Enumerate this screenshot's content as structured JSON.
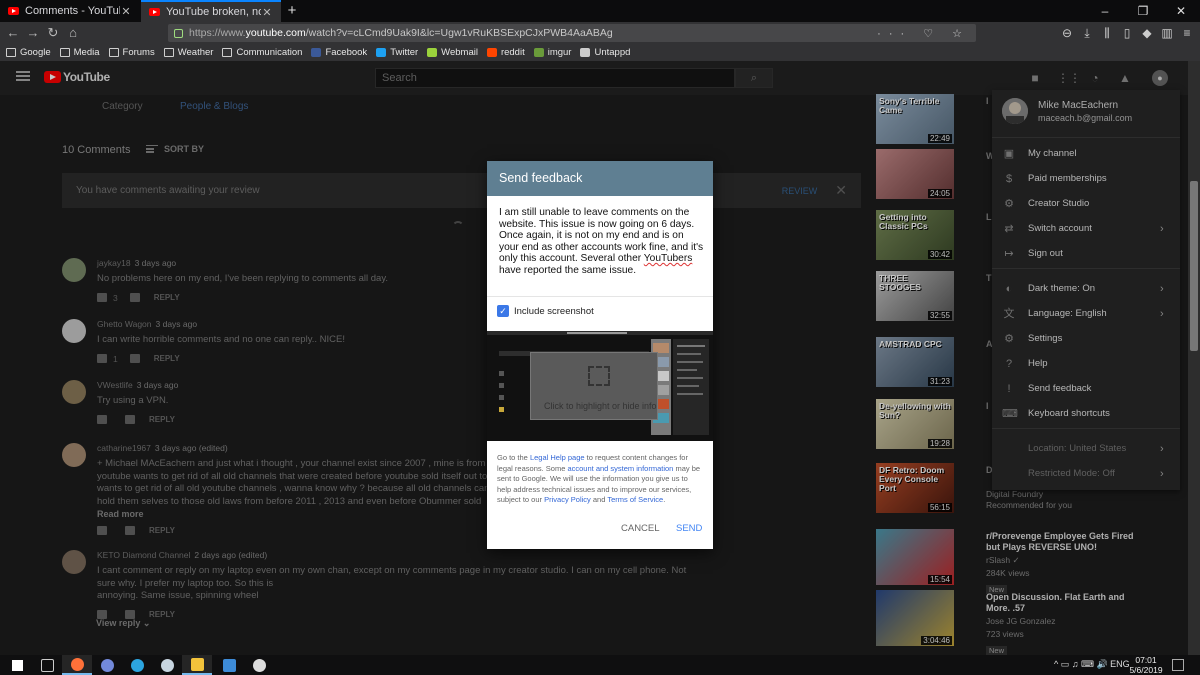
{
  "browser": {
    "tabs": [
      {
        "title": "Comments - YouTube",
        "active": false
      },
      {
        "title": "YouTube broken, no longer can...",
        "active": true
      }
    ],
    "new_tab_glyph": "+",
    "window_controls": [
      "–",
      "❐",
      "✕"
    ],
    "url_scheme": "https://www.",
    "url_host": "youtube.com",
    "url_path": "/watch?v=cLCmd9Uak9I&lc=Ugw1vRuKBSExpCJxPWB4AaABAg",
    "url_icons": "··· ♡ ☆",
    "bookmarks": [
      {
        "label": "Google",
        "icon": "folder-icon"
      },
      {
        "label": "Media",
        "icon": "folder-icon"
      },
      {
        "label": "Forums",
        "icon": "folder-icon"
      },
      {
        "label": "Weather",
        "icon": "folder-icon"
      },
      {
        "label": "Communication",
        "icon": "folder-icon"
      },
      {
        "label": "Facebook",
        "icon": "facebook-icon",
        "color": "#3b5998"
      },
      {
        "label": "Twitter",
        "icon": "twitter-icon",
        "color": "#1da1f2"
      },
      {
        "label": "Webmail",
        "icon": "webmail-icon",
        "color": "#9bd33c"
      },
      {
        "label": "reddit",
        "icon": "reddit-icon",
        "color": "#ff4500"
      },
      {
        "label": "imgur",
        "icon": "imgur-icon",
        "color": "#6a9b3a"
      },
      {
        "label": "Untappd",
        "icon": "untappd-icon",
        "color": "#cccccc"
      }
    ]
  },
  "youtube": {
    "logo_text": "YouTube",
    "search_placeholder": "Search",
    "category_label": "Category",
    "category_value": "People & Blogs",
    "comment_count": "10 Comments",
    "sort_label": "SORT BY",
    "review_banner": {
      "text": "You have comments awaiting your review",
      "button": "REVIEW",
      "close": "✕"
    },
    "reply_label": "REPLY",
    "comments": [
      {
        "author": "jaykay18",
        "time": "3 days ago",
        "lines": [
          "No problems here on my end, I've been replying to comments all day."
        ],
        "likes": "3",
        "avatar_color": "#7a8a6a"
      },
      {
        "author": "Ghetto Wagon",
        "time": "3 days ago",
        "lines": [
          "I can write horrible comments and no one can reply.. NICE!"
        ],
        "likes": "1",
        "avatar_color": "#c8c8c8"
      },
      {
        "author": "VWestlife",
        "time": "3 days ago",
        "lines": [
          "Try using a VPN."
        ],
        "likes": "",
        "avatar_color": "#8c7a5a"
      },
      {
        "author": "catharine1967",
        "time": "3 days ago (edited)",
        "lines": [
          "+ Michael MAcEachern and just what i thought , your channel exist since 2007 , mine is from 2009 ,",
          "youtube wants to get rid of all old channels that were created before youtube sold itself out to google,",
          "wants to get rid of all old youtube channels , wanna know why ? because all old channels can still",
          "hold them selves to those old laws from before 2011 , 2013 and even before Obummer sold"
        ],
        "read_more": "Read more",
        "likes": "",
        "avatar_color": "#a58a70"
      },
      {
        "author": "KETO Diamond Channel",
        "time": "2 days ago (edited)",
        "lines": [
          "I cant comment or reply on my laptop even on my own chan, except on my comments page in my creator studio. I can on my cell phone. Not sure why. I prefer my laptop too. So this is",
          "annoying. Same issue, spinning wheel"
        ],
        "likes": "",
        "avatar_color": "#7a6a5a"
      }
    ],
    "view_reply": "View reply ⌄",
    "sidebar_videos": [
      {
        "thumb_text": "Sony's Terrible Came",
        "duration": "22:49",
        "title_char": "I",
        "colors": [
          "#9db3c8",
          "#5a6f82"
        ]
      },
      {
        "thumb_text": "",
        "duration": "24:05",
        "title_char": "W",
        "colors": [
          "#c68a8a",
          "#6b3b3b"
        ]
      },
      {
        "thumb_text": "Getting into Classic PCs",
        "duration": "30:42",
        "title_char": "L",
        "colors": [
          "#7a8c5a",
          "#3b4a2a"
        ]
      },
      {
        "thumb_text": "THREE STOOGES",
        "duration": "32:55",
        "title_char": "T",
        "colors": [
          "#c8c8c8",
          "#555555"
        ]
      },
      {
        "thumb_text": "AMSTRAD CPC",
        "duration": "31:23",
        "title_char": "A",
        "colors": [
          "#8a9aac",
          "#33475a"
        ]
      },
      {
        "thumb_text": "De-yellowing with Sun?",
        "duration": "19:28",
        "title_char": "I",
        "colors": [
          "#d8d2b0",
          "#8a8260"
        ]
      },
      {
        "thumb_text": "DF Retro: Doom Every Console Port",
        "duration": "56:15",
        "title_char": "D",
        "colors": [
          "#c0502a",
          "#4a1a10"
        ]
      }
    ],
    "sidebar_wide": [
      {
        "title": "r/Prorevenge Employee Gets Fired but Plays REVERSE UNO!",
        "channel": "rSlash ✓",
        "views": "284K views",
        "badge": "New",
        "duration": "15:54",
        "colors": [
          "#4a9ab0",
          "#c8282a"
        ]
      },
      {
        "title": "Open Discussion. Flat Earth and More. .57",
        "channel": "Jose JG Gonzalez",
        "views": "723 views",
        "badge": "New",
        "duration": "3:04:46",
        "colors": [
          "#2a4a8a",
          "#c8a83a"
        ]
      }
    ],
    "df_channel": "Digital Foundry",
    "df_rec": "Recommended for you"
  },
  "account_menu": {
    "name": "Mike MacEachern",
    "email": "maceach.b@gmail.com",
    "items": [
      {
        "label": "My channel",
        "icon": "person-icon",
        "glyph": "▣",
        "chevron": false
      },
      {
        "label": "Paid memberships",
        "icon": "dollar-icon",
        "glyph": "$",
        "chevron": false
      },
      {
        "label": "Creator Studio",
        "icon": "gear-icon",
        "glyph": "⚙",
        "chevron": false
      },
      {
        "label": "Switch account",
        "icon": "switch-account-icon",
        "glyph": "⇄",
        "chevron": true
      },
      {
        "label": "Sign out",
        "icon": "sign-out-icon",
        "glyph": "↦",
        "chevron": false
      },
      {
        "label": "Dark theme: On",
        "icon": "moon-icon",
        "glyph": "◐",
        "chevron": true
      },
      {
        "label": "Language: English",
        "icon": "translate-icon",
        "glyph": "文",
        "chevron": true
      },
      {
        "label": "Settings",
        "icon": "settings-icon",
        "glyph": "⚙",
        "chevron": false
      },
      {
        "label": "Help",
        "icon": "help-icon",
        "glyph": "?",
        "chevron": false
      },
      {
        "label": "Send feedback",
        "icon": "feedback-icon",
        "glyph": "!",
        "chevron": false
      },
      {
        "label": "Keyboard shortcuts",
        "icon": "keyboard-icon",
        "glyph": "⌨",
        "chevron": false
      },
      {
        "label": "Location: United States",
        "icon": "",
        "glyph": "",
        "chevron": true,
        "dim": true
      },
      {
        "label": "Restricted Mode: Off",
        "icon": "",
        "glyph": "",
        "chevron": true,
        "dim": true
      }
    ]
  },
  "feedback_dialog": {
    "title": "Send feedback",
    "message_parts": [
      "I am still unable to leave comments on the website.  This issue is now going on 6 days.  Once again, it is not on my end and is on your end as other accounts work fine, and it's only this account.  Several other ",
      "YouTubers",
      " have reported the same issue."
    ],
    "include_screenshot": "Include screenshot",
    "screenshot_hint": "Click to highlight or hide info",
    "legal": {
      "p1": "Go to the ",
      "link1": "Legal Help page",
      "p2": " to request content changes for legal reasons. Some ",
      "link2": "account and system information",
      "p3": " may be sent to Google. We will use the information you give us to help address technical issues and to improve our services, subject to our ",
      "link3": "Privacy Policy",
      "p4": " and ",
      "link4": "Terms of Service",
      "p5": "."
    },
    "cancel": "CANCEL",
    "send": "SEND"
  },
  "taskbar": {
    "time": "07:01",
    "date": "5/6/2019",
    "tray": "^ ▭ ♫ ⌨ 🔊 ENG",
    "apps": [
      {
        "name": "windows-start-icon",
        "color": "#ffffff"
      },
      {
        "name": "task-view-icon",
        "color": "#cccccc"
      },
      {
        "name": "firefox-icon",
        "color": "#ff7139"
      },
      {
        "name": "discord-icon",
        "color": "#7289da"
      },
      {
        "name": "telegram-icon",
        "color": "#2ca5e0"
      },
      {
        "name": "steam-icon",
        "color": "#c7d5e0"
      },
      {
        "name": "file-explorer-icon",
        "color": "#f3c33b"
      },
      {
        "name": "remote-desktop-icon",
        "color": "#3d8bd8"
      },
      {
        "name": "photos-icon",
        "color": "#dddddd"
      }
    ]
  }
}
